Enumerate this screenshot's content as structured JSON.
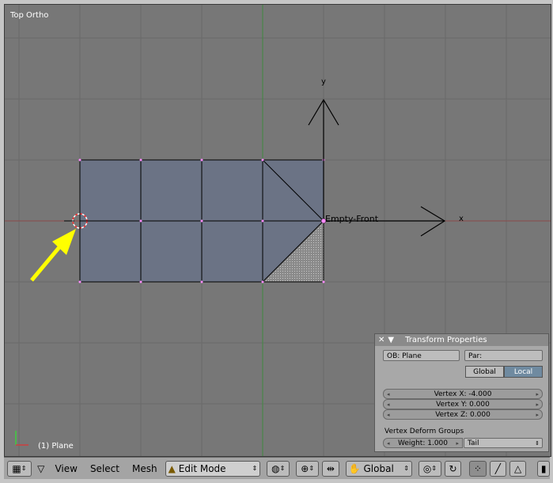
{
  "viewport": {
    "title": "Top Ortho",
    "object_label": "(1) Plane",
    "empty_label": "Empty-Front",
    "axis_x": "x",
    "axis_y": "y"
  },
  "transform_panel": {
    "title": "Transform Properties",
    "ob_field": "OB: Plane",
    "par_field": "Par:",
    "global_label": "Global",
    "local_label": "Local",
    "vertex_x": "Vertex X: -4.000",
    "vertex_y": "Vertex Y: 0.000",
    "vertex_z": "Vertex Z: 0.000",
    "deform_groups_label": "Vertex Deform Groups",
    "weight": "Weight: 1.000",
    "group_name": "Tail"
  },
  "header": {
    "menus": [
      "View",
      "Select",
      "Mesh"
    ],
    "mode": "Edit Mode",
    "orientation": "Global"
  },
  "colors": {
    "viewport_bg": "#777777",
    "mesh_face": "#6b7385",
    "vertex": "#ff8cff",
    "arrow": "#ffff00",
    "cursor": "#ff3030"
  }
}
